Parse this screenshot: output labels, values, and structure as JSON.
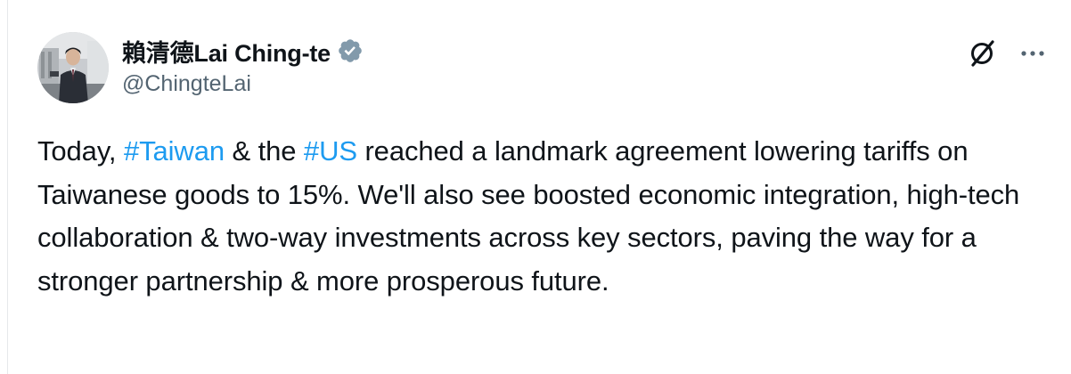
{
  "author": {
    "display_name": "賴清德Lai Ching-te",
    "handle": "@ChingteLai",
    "verified": true,
    "verified_color": "#829aab"
  },
  "post": {
    "segments": [
      {
        "text": "Today, ",
        "hashtag": false
      },
      {
        "text": "#Taiwan",
        "hashtag": true
      },
      {
        "text": " & the ",
        "hashtag": false
      },
      {
        "text": "#US",
        "hashtag": true
      },
      {
        "text": " reached a landmark agreement lowering tariffs on Taiwanese goods to 15%. We'll also see boosted economic integration, high-tech collaboration & two-way investments across key sectors, paving the way for a stronger partnership & more prosperous future.",
        "hashtag": false
      }
    ]
  },
  "actions": {
    "grok_icon": "grok-icon",
    "more_icon": "more-icon"
  },
  "colors": {
    "text": "#0f1419",
    "secondary": "#536471",
    "link": "#1d9bf0"
  }
}
